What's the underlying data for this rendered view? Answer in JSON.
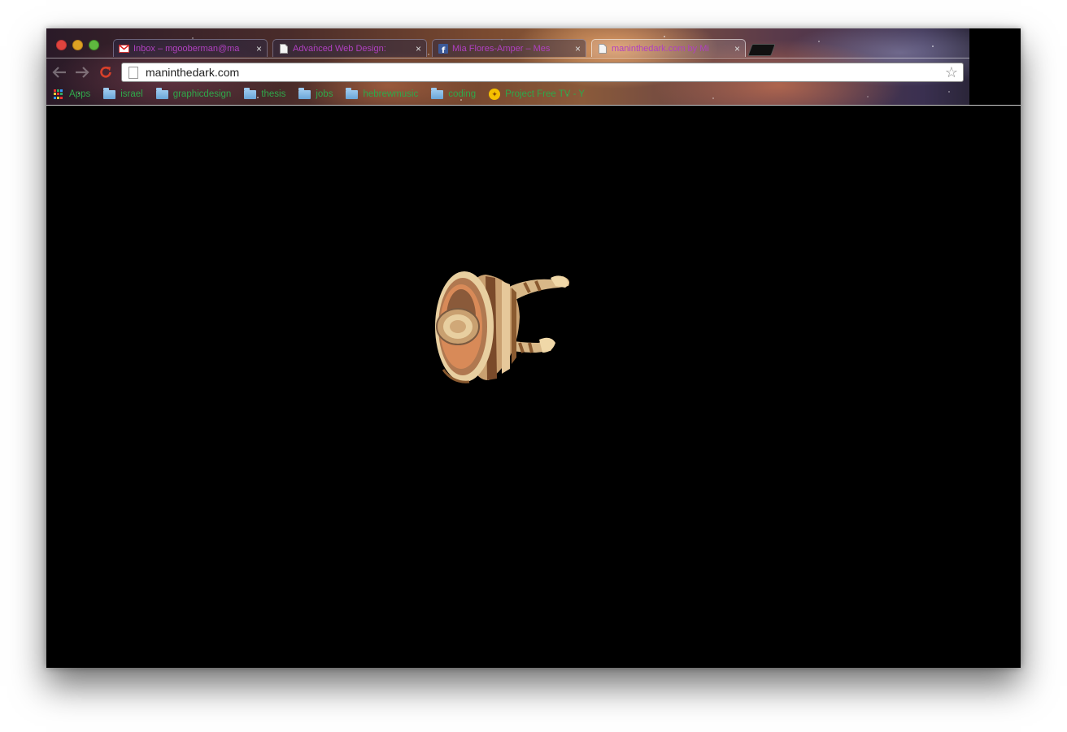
{
  "window": {
    "controls": [
      "close",
      "minimize",
      "maximize"
    ]
  },
  "tabs": [
    {
      "title": "Inbox – mgooberman@ma",
      "favicon": "gmail-icon",
      "active": false
    },
    {
      "title": "Advanced Web Design: ",
      "favicon": "page-icon",
      "active": false
    },
    {
      "title": "Mia Flores-Amper – Mes",
      "favicon": "facebook-icon",
      "active": false
    },
    {
      "title": "maninthedark.com by Mi",
      "favicon": "page-icon",
      "active": true
    }
  ],
  "toolbar": {
    "url": "maninthedark.com",
    "back_icon": "back-arrow-icon",
    "forward_icon": "forward-arrow-icon",
    "reload_icon": "reload-icon",
    "bookmark_star_icon": "star-icon",
    "extension_icon": "adblock-stop-icon",
    "menu_icon": "hamburger-menu-icon"
  },
  "bookmarks": [
    {
      "label": "Apps",
      "type": "apps"
    },
    {
      "label": "israel",
      "type": "folder"
    },
    {
      "label": "graphicdesign",
      "type": "folder"
    },
    {
      "label": "thesis",
      "type": "folder"
    },
    {
      "label": "jobs",
      "type": "folder"
    },
    {
      "label": "hebrewmusic",
      "type": "folder"
    },
    {
      "label": "coding",
      "type": "folder"
    },
    {
      "label": "Project Free TV - Y",
      "type": "site"
    }
  ],
  "colors": {
    "tab_text": "#b040c0",
    "bookmark_text": "#2fa84a",
    "accent_red": "#d8402a",
    "page_background": "#000000"
  }
}
